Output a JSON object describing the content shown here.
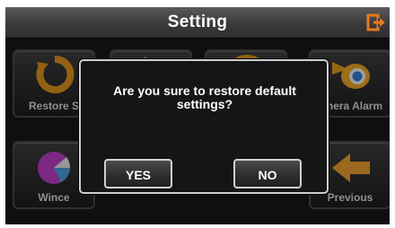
{
  "header": {
    "title": "Setting",
    "exit_icon": "exit-icon"
  },
  "tiles": [
    {
      "label": "Restore S",
      "icon": "restore-icon"
    },
    {
      "label": "",
      "icon": "pen-icon"
    },
    {
      "label": "",
      "icon": "gear-icon"
    },
    {
      "label": "amera Alarm",
      "icon": "camera-alarm-icon"
    },
    {
      "label": "Wince",
      "icon": "wince-icon"
    },
    {
      "label": "Previous",
      "icon": "back-arrow-icon"
    }
  ],
  "dialog": {
    "message": "Are you sure to restore default settings?",
    "yes_label": "YES",
    "no_label": "NO"
  },
  "colors": {
    "accent": "#e87a1a",
    "background": "#171717"
  }
}
